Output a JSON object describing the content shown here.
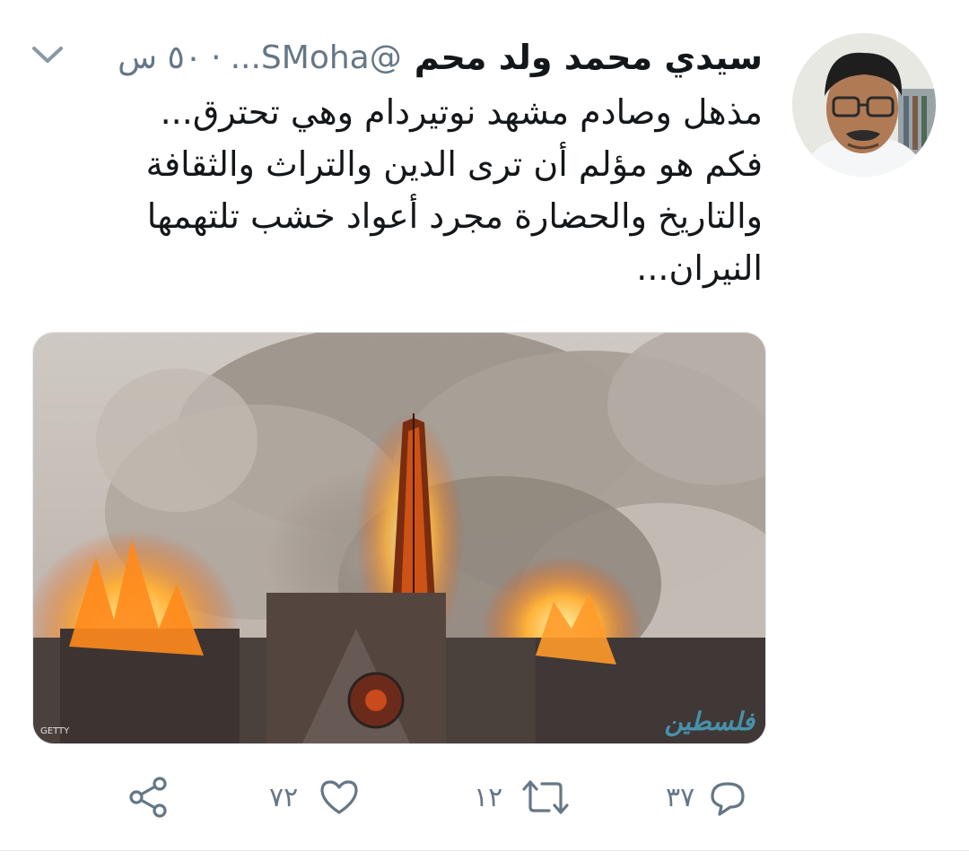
{
  "tweet": {
    "display_name": "سيدي محمد ولد محم",
    "handle": "@SMoha...",
    "separator": "·",
    "timestamp": "٥٠ س",
    "text_lines": [
      "مذهل وصادم مشهد نوتيردام وهي تحترق...",
      "فكم هو مؤلم أن ترى الدين والتراث والثقافة",
      "والتاريخ والحضارة مجرد أعواد خشب تلتهمها",
      "النيران..."
    ],
    "media": {
      "credit": "GETTY",
      "watermark": "فلسطين"
    },
    "actions": {
      "reply_count": "٣٧",
      "retweet_count": "١٢",
      "like_count": "٧٢"
    }
  },
  "colors": {
    "text": "#14171a",
    "secondary": "#657786",
    "divider": "#e6ecf0"
  },
  "icons": [
    "chevron-down-icon",
    "reply-icon",
    "retweet-icon",
    "like-icon",
    "share-icon"
  ]
}
